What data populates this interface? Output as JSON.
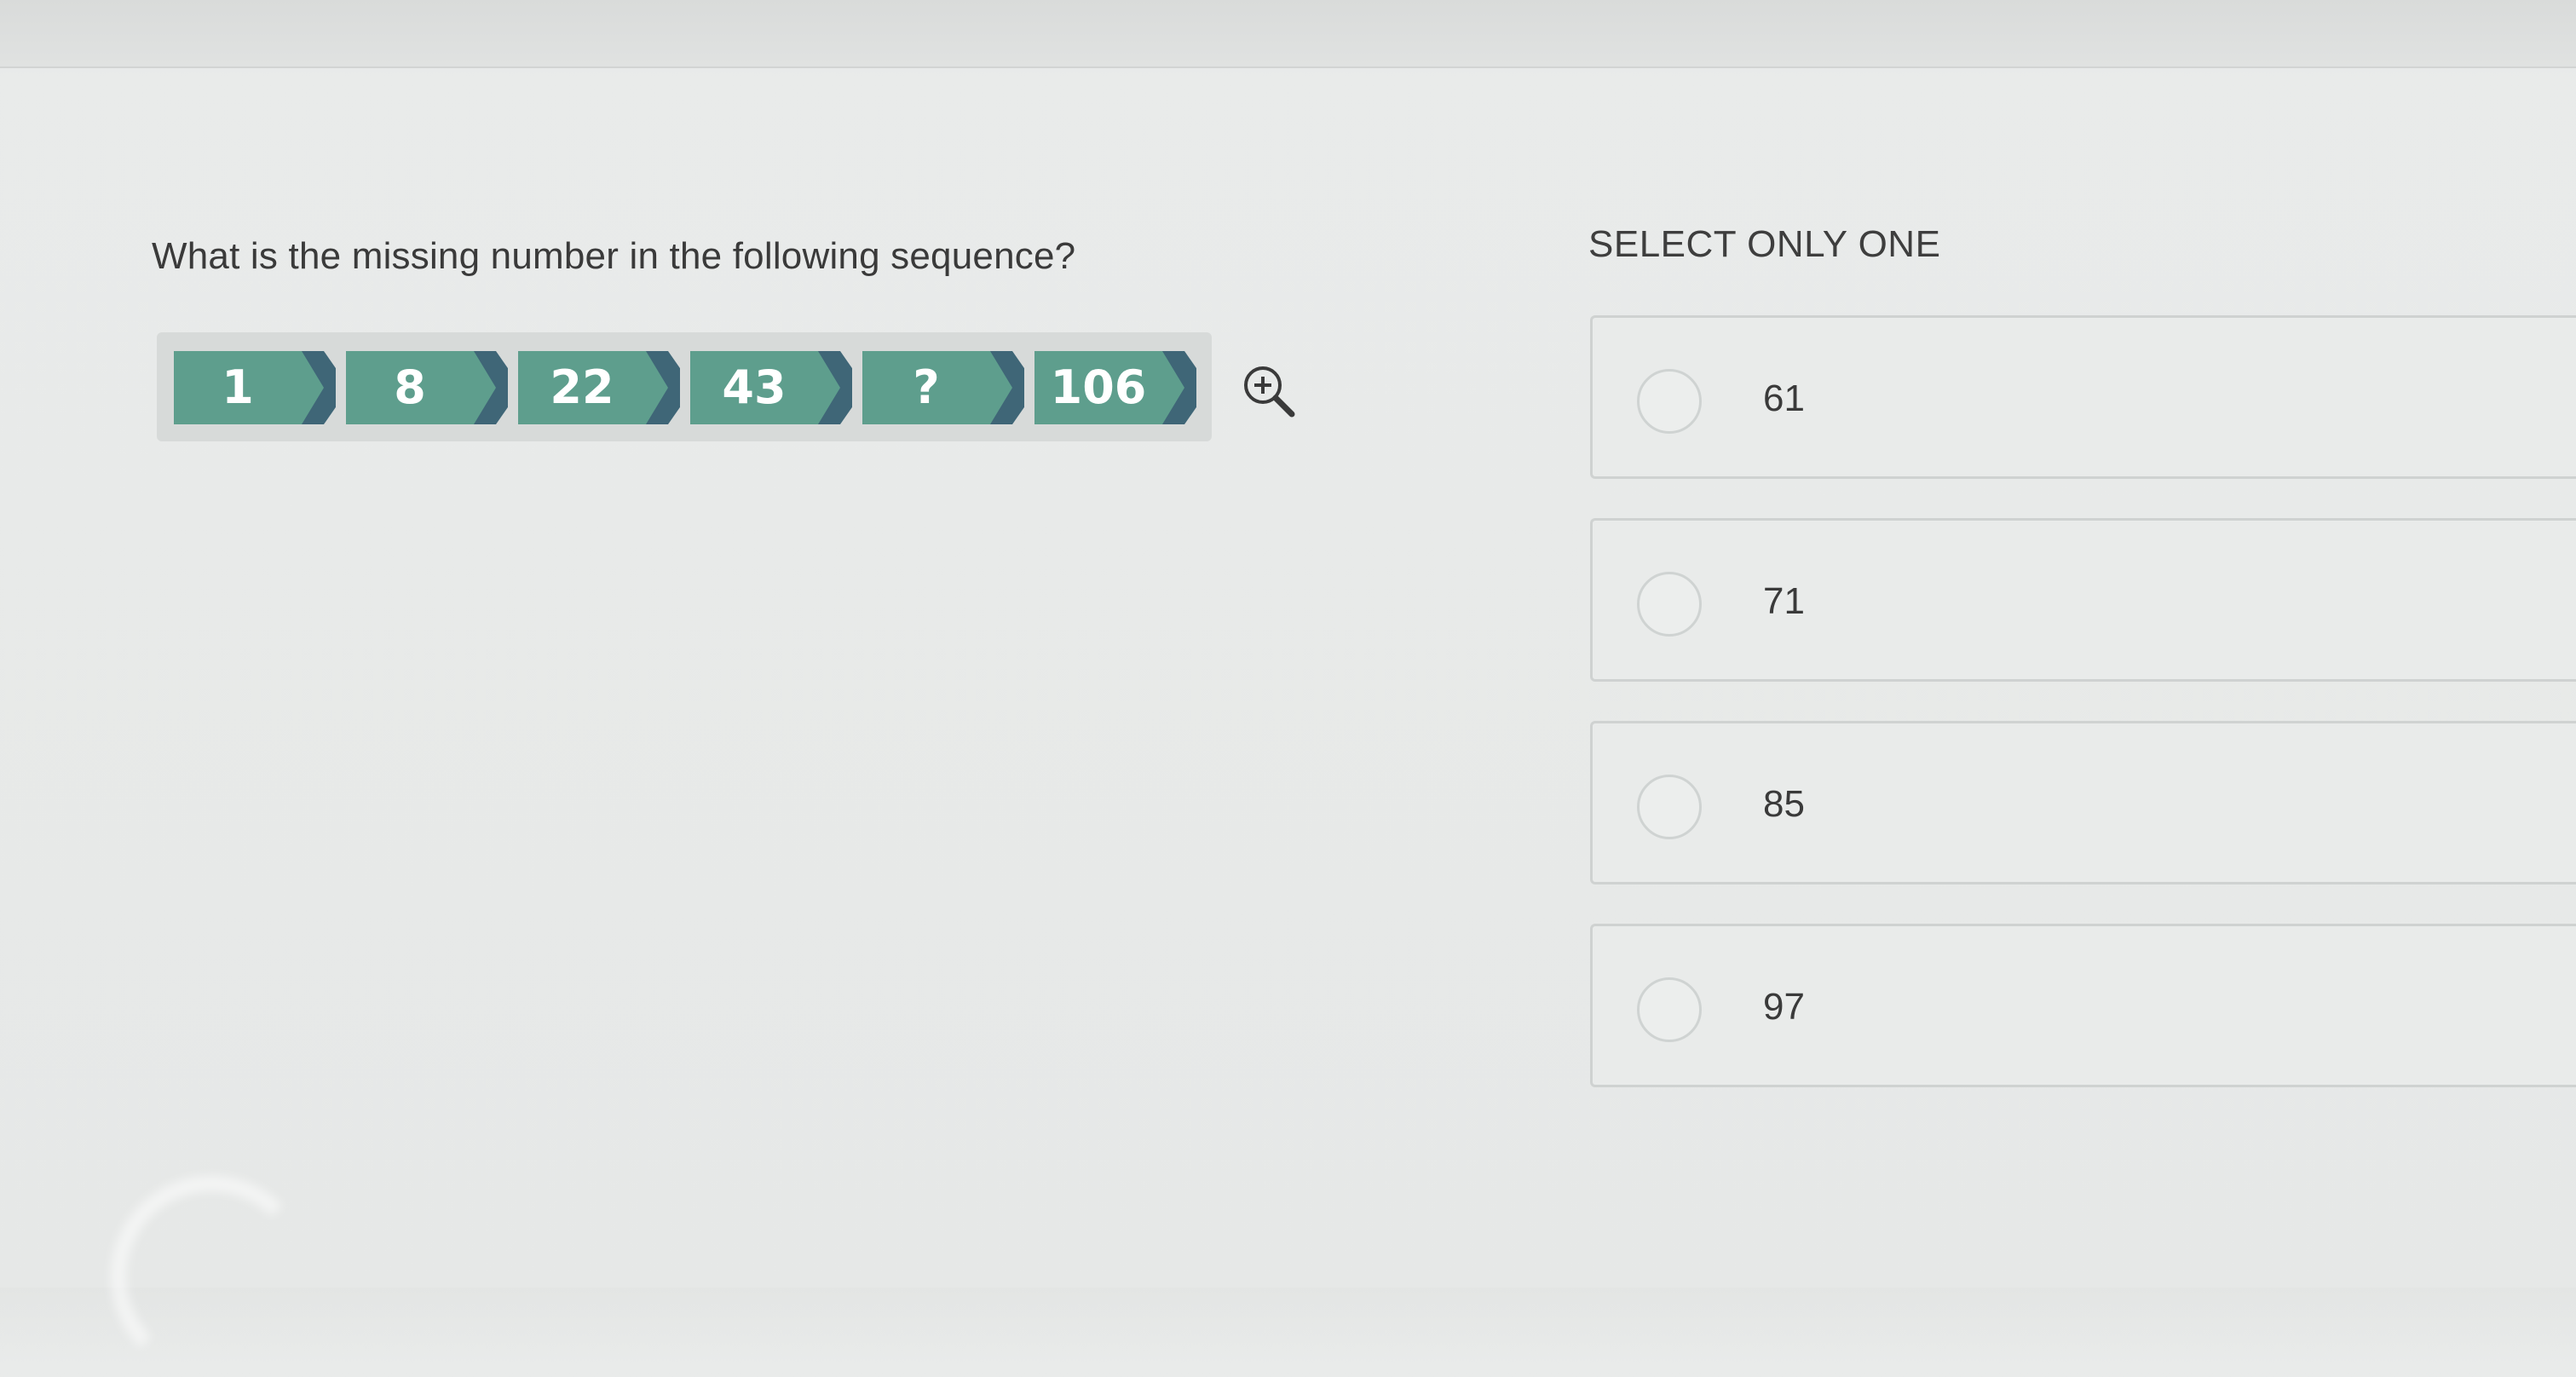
{
  "question": {
    "text": "What is the missing number in the following sequence?"
  },
  "sequence": {
    "items": [
      "1",
      "8",
      "22",
      "43",
      "?",
      "106"
    ],
    "box_color": "#5e9e8d",
    "chevron_color": "#3f6677"
  },
  "zoom": {
    "icon": "zoom-in-icon"
  },
  "options": {
    "heading": "SELECT ONLY ONE",
    "choices": [
      "61",
      "71",
      "85",
      "97"
    ]
  }
}
